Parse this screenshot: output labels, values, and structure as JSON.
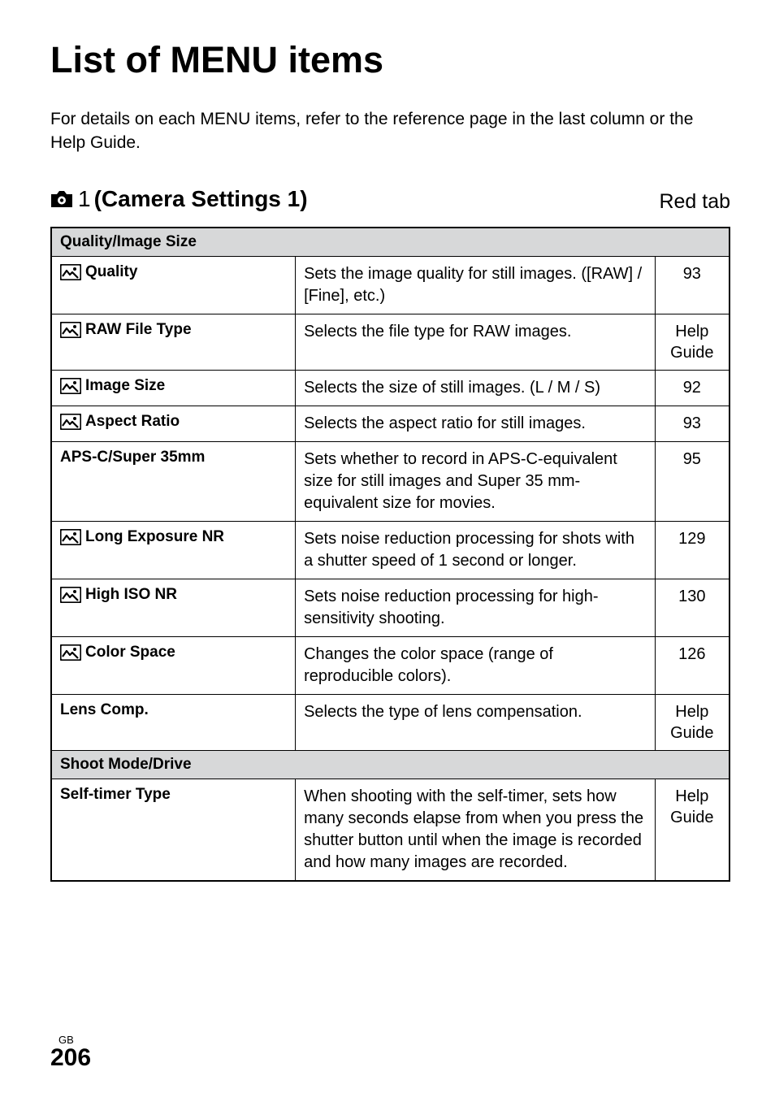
{
  "title": "List of MENU items",
  "intro": "For details on each MENU items, refer to the reference page in the last column or the Help Guide.",
  "section": {
    "camNumber": "1",
    "title": "(Camera Settings 1)",
    "tabLabel": "Red tab"
  },
  "groups": [
    {
      "header": "Quality/Image Size",
      "rows": [
        {
          "hasIcon": true,
          "label": "Quality",
          "desc": "Sets the image quality for still images. ([RAW] / [Fine], etc.)",
          "page": "93"
        },
        {
          "hasIcon": true,
          "label": "RAW File Type",
          "desc": "Selects the file type for RAW images.",
          "page": "Help Guide"
        },
        {
          "hasIcon": true,
          "label": "Image Size",
          "desc": "Selects the size of still images. (L / M / S)",
          "page": "92"
        },
        {
          "hasIcon": true,
          "label": "Aspect Ratio",
          "desc": "Selects the aspect ratio for still images.",
          "page": "93"
        },
        {
          "hasIcon": false,
          "label": "APS-C/Super 35mm",
          "desc": "Sets whether to record in APS-C-equivalent size for still images and Super 35 mm-equivalent size for movies.",
          "page": "95"
        },
        {
          "hasIcon": true,
          "label": "Long Exposure NR",
          "desc": "Sets noise reduction processing for shots with a shutter speed of 1 second or longer.",
          "page": "129"
        },
        {
          "hasIcon": true,
          "label": "High ISO NR",
          "desc": "Sets noise reduction processing for high-sensitivity shooting.",
          "page": "130"
        },
        {
          "hasIcon": true,
          "label": "Color Space",
          "desc": "Changes the color space (range of reproducible colors).",
          "page": "126"
        },
        {
          "hasIcon": false,
          "label": "Lens Comp.",
          "desc": "Selects the type of lens compensation.",
          "page": "Help Guide"
        }
      ]
    },
    {
      "header": "Shoot Mode/Drive",
      "rows": [
        {
          "hasIcon": false,
          "label": "Self-timer Type",
          "desc": "When shooting with the self-timer, sets how many seconds elapse from when you press the shutter button until when the image is recorded and how many images are recorded.",
          "page": "Help Guide"
        }
      ]
    }
  ],
  "footer": {
    "gb": "GB",
    "pageNum": "206"
  }
}
